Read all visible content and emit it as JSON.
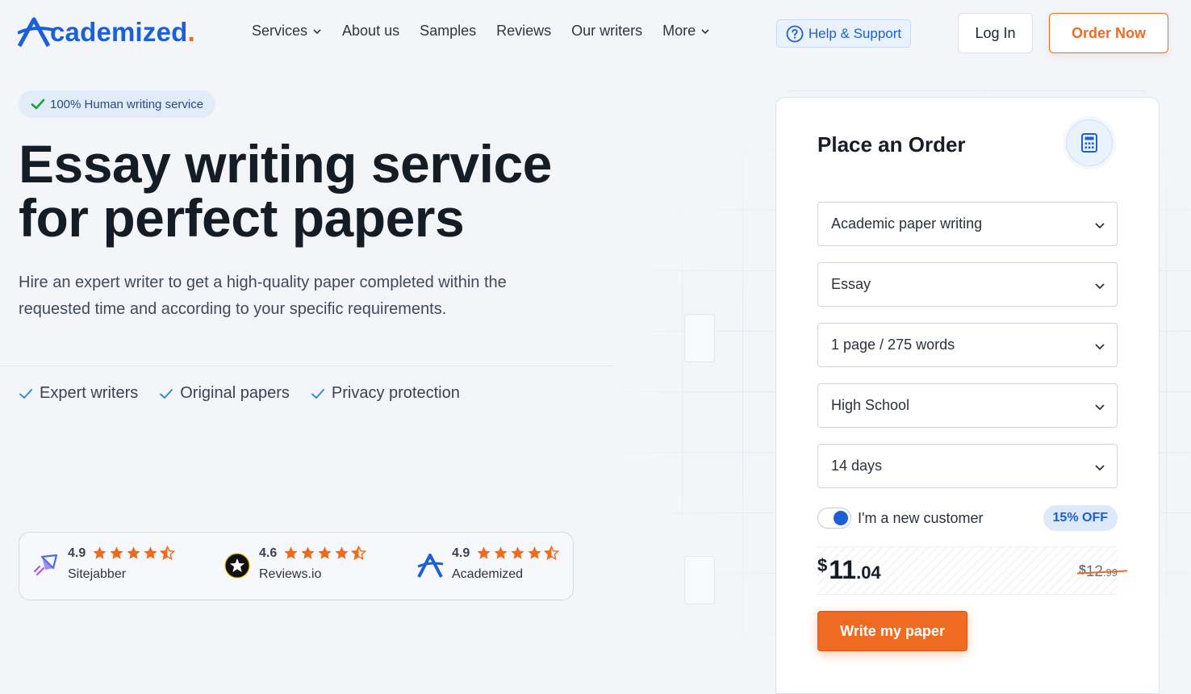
{
  "header": {
    "logo_text": "cademized",
    "logo_dot": ".",
    "nav": [
      {
        "label": "Services",
        "dropdown": true
      },
      {
        "label": "About us",
        "dropdown": false
      },
      {
        "label": "Samples",
        "dropdown": false
      },
      {
        "label": "Reviews",
        "dropdown": false
      },
      {
        "label": "Our writers",
        "dropdown": false
      },
      {
        "label": "More",
        "dropdown": true
      }
    ],
    "help_label": "Help & Support",
    "login_label": "Log In",
    "order_label": "Order Now"
  },
  "hero": {
    "badge": "100% Human writing service",
    "title_line1": "Essay writing service",
    "title_line2": "for perfect papers",
    "subtitle": "Hire an expert writer to get a high-quality paper completed within the requested time and according to your specific requirements.",
    "features": [
      "Expert writers",
      "Original papers",
      "Privacy protection"
    ]
  },
  "ratings": [
    {
      "score": "4.9",
      "name": "Sitejabber",
      "icon": "sitejabber-icon"
    },
    {
      "score": "4.6",
      "name": "Reviews.io",
      "icon": "reviewsio-icon"
    },
    {
      "score": "4.9",
      "name": "Academized",
      "icon": "academized-icon"
    }
  ],
  "order_form": {
    "title": "Place an Order",
    "fields": {
      "service": "Academic paper writing",
      "paper_type": "Essay",
      "pages": "1 page / 275 words",
      "level": "High School",
      "deadline": "14 days"
    },
    "new_customer_label": "I'm a new customer",
    "new_customer_checked": true,
    "discount": "15% OFF",
    "price": {
      "currency": "$",
      "integer": "11",
      "decimal": ".04"
    },
    "old_price": {
      "currency": "$",
      "integer": "12",
      "decimal": ".99"
    },
    "cta_label": "Write my paper"
  },
  "colors": {
    "brand_blue": "#1d5fd6",
    "accent_orange": "#ef6b22",
    "background": "#f3f5f9"
  }
}
